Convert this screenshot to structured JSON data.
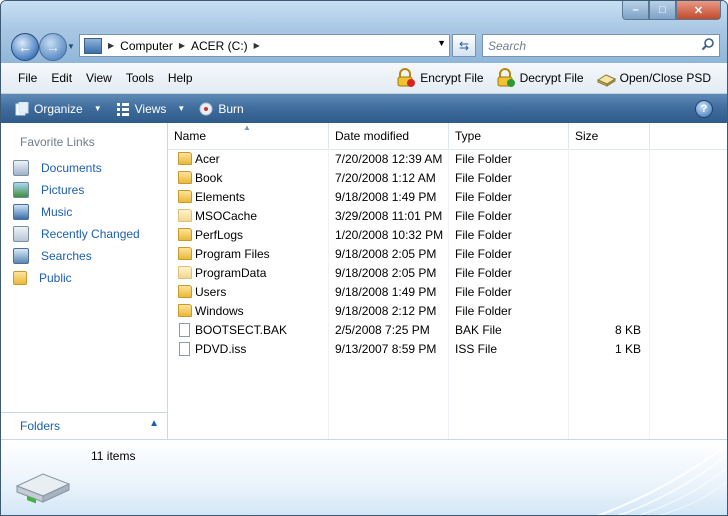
{
  "address": {
    "crumbs": [
      "Computer",
      "ACER (C:)"
    ]
  },
  "search": {
    "placeholder": "Search"
  },
  "menu": [
    "File",
    "Edit",
    "View",
    "Tools",
    "Help"
  ],
  "tools": {
    "encrypt": "Encrypt File",
    "decrypt": "Decrypt File",
    "openclose": "Open/Close PSD"
  },
  "commands": {
    "organize": "Organize",
    "views": "Views",
    "burn": "Burn"
  },
  "nav": {
    "title": "Favorite Links",
    "links": [
      "Documents",
      "Pictures",
      "Music",
      "Recently Changed",
      "Searches",
      "Public"
    ],
    "folders_label": "Folders"
  },
  "columns": {
    "name": "Name",
    "date": "Date modified",
    "type": "Type",
    "size": "Size"
  },
  "files": [
    {
      "name": "Acer",
      "date": "7/20/2008 12:39 AM",
      "type": "File Folder",
      "size": ""
    },
    {
      "name": "Book",
      "date": "7/20/2008 1:12 AM",
      "type": "File Folder",
      "size": ""
    },
    {
      "name": "Elements",
      "date": "9/18/2008 1:49 PM",
      "type": "File Folder",
      "size": ""
    },
    {
      "name": "MSOCache",
      "date": "3/29/2008 11:01 PM",
      "type": "File Folder",
      "size": ""
    },
    {
      "name": "PerfLogs",
      "date": "1/20/2008 10:32 PM",
      "type": "File Folder",
      "size": ""
    },
    {
      "name": "Program Files",
      "date": "9/18/2008 2:05 PM",
      "type": "File Folder",
      "size": ""
    },
    {
      "name": "ProgramData",
      "date": "9/18/2008 2:05 PM",
      "type": "File Folder",
      "size": ""
    },
    {
      "name": "Users",
      "date": "9/18/2008 1:49 PM",
      "type": "File Folder",
      "size": ""
    },
    {
      "name": "Windows",
      "date": "9/18/2008 2:12 PM",
      "type": "File Folder",
      "size": ""
    },
    {
      "name": "BOOTSECT.BAK",
      "date": "2/5/2008 7:25 PM",
      "type": "BAK File",
      "size": "8 KB"
    },
    {
      "name": "PDVD.iss",
      "date": "9/13/2007 8:59 PM",
      "type": "ISS File",
      "size": "1 KB"
    }
  ],
  "status": {
    "count": "11 items"
  }
}
